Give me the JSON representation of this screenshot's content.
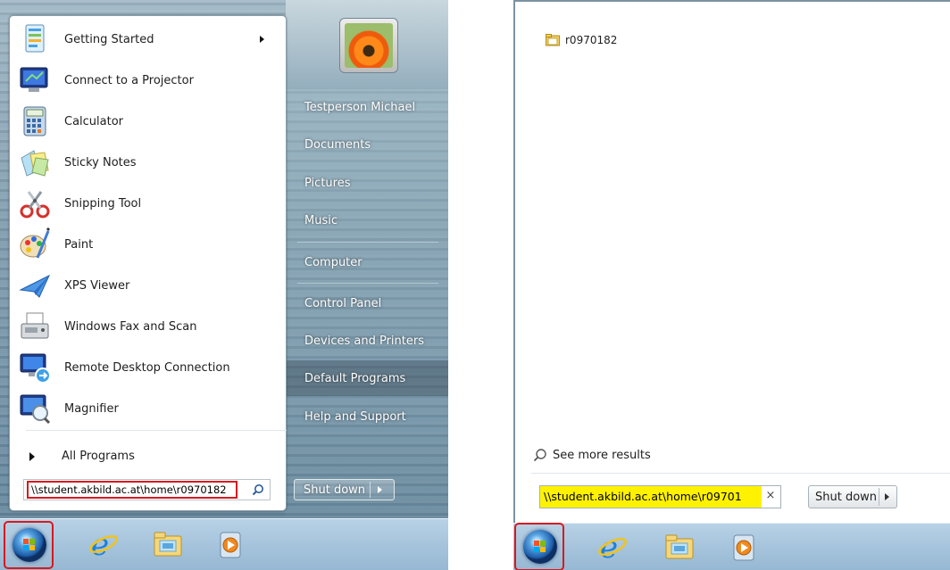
{
  "left_menu": {
    "programs": [
      {
        "label": "Getting Started",
        "icon": "getting-started-icon",
        "has_submenu": true
      },
      {
        "label": "Connect to a Projector",
        "icon": "projector-icon"
      },
      {
        "label": "Calculator",
        "icon": "calculator-icon"
      },
      {
        "label": "Sticky Notes",
        "icon": "sticky-notes-icon"
      },
      {
        "label": "Snipping Tool",
        "icon": "snipping-tool-icon"
      },
      {
        "label": "Paint",
        "icon": "paint-icon"
      },
      {
        "label": "XPS Viewer",
        "icon": "xps-viewer-icon"
      },
      {
        "label": "Windows Fax and Scan",
        "icon": "fax-scan-icon"
      },
      {
        "label": "Remote Desktop Connection",
        "icon": "remote-desktop-icon"
      },
      {
        "label": "Magnifier",
        "icon": "magnifier-icon"
      }
    ],
    "all_programs": "All Programs",
    "search_value": "\\\\student.akbild.ac.at\\home\\r0970182",
    "user_name": "Testperson Michael",
    "right_items": [
      "Documents",
      "Pictures",
      "Music",
      "Computer",
      "Control Panel",
      "Devices and Printers",
      "Default Programs",
      "Help and Support"
    ],
    "shutdown": "Shut down",
    "highlight_color": "#d71920"
  },
  "right_menu": {
    "result_folder": "r0970182",
    "see_more": "See more results",
    "search_value": "\\\\student.akbild.ac.at\\home\\r09701",
    "search_highlight_color": "#fff200",
    "clear_glyph": "×",
    "shutdown": "Shut down"
  },
  "taskbar": {
    "icons": [
      "start-orb-icon",
      "internet-explorer-icon",
      "windows-explorer-icon",
      "media-player-icon"
    ]
  }
}
